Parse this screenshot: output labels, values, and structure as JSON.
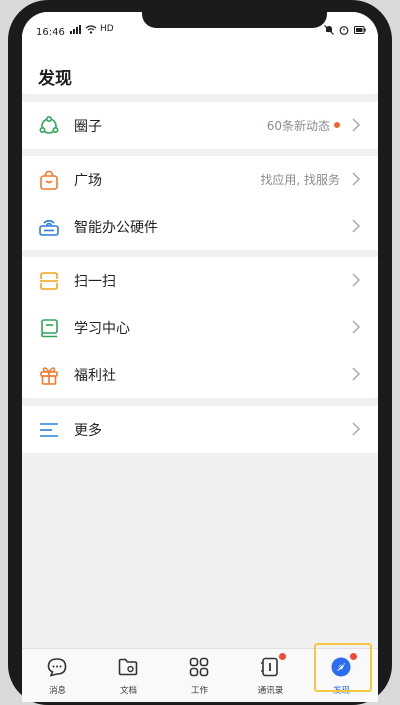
{
  "status_bar": {
    "time": "16:46",
    "network": "HD",
    "right_peek": "16:46"
  },
  "header": {
    "title": "发现"
  },
  "groups": [
    {
      "items": [
        {
          "label": "圈子",
          "trailing": "60条新动态",
          "has_dot": true,
          "icon": "moments-icon",
          "color": "#2fa55a"
        }
      ]
    },
    {
      "items": [
        {
          "label": "广场",
          "trailing": "找应用, 找服务",
          "icon": "shopping-bag-icon",
          "color": "#f07a2e"
        },
        {
          "label": "智能办公硬件",
          "trailing": "",
          "icon": "hardware-icon",
          "color": "#2b7de0"
        }
      ]
    },
    {
      "items": [
        {
          "label": "扫一扫",
          "trailing": "",
          "icon": "scan-icon",
          "color": "#f2a31c"
        },
        {
          "label": "学习中心",
          "trailing": "",
          "icon": "book-icon",
          "color": "#2fa55a"
        },
        {
          "label": "福利社",
          "trailing": "",
          "icon": "gift-icon",
          "color": "#f07a2e"
        }
      ]
    },
    {
      "items": [
        {
          "label": "更多",
          "trailing": "",
          "icon": "menu-icon",
          "color": "#2b7de0"
        }
      ]
    }
  ],
  "tabs": [
    {
      "label": "消息",
      "icon": "chat-bubble-icon",
      "active": false,
      "badge": false
    },
    {
      "label": "文档",
      "icon": "folder-icon",
      "active": false,
      "badge": false
    },
    {
      "label": "工作",
      "icon": "grid-icon",
      "active": false,
      "badge": false
    },
    {
      "label": "通讯录",
      "icon": "contacts-icon",
      "active": false,
      "badge": true
    },
    {
      "label": "发现",
      "icon": "compass-icon",
      "active": true,
      "badge": true
    }
  ],
  "colors": {
    "accent": "#2b6df0",
    "badge": "#f04a3a",
    "highlight": "#f5c842",
    "background": "#eff0f2"
  }
}
